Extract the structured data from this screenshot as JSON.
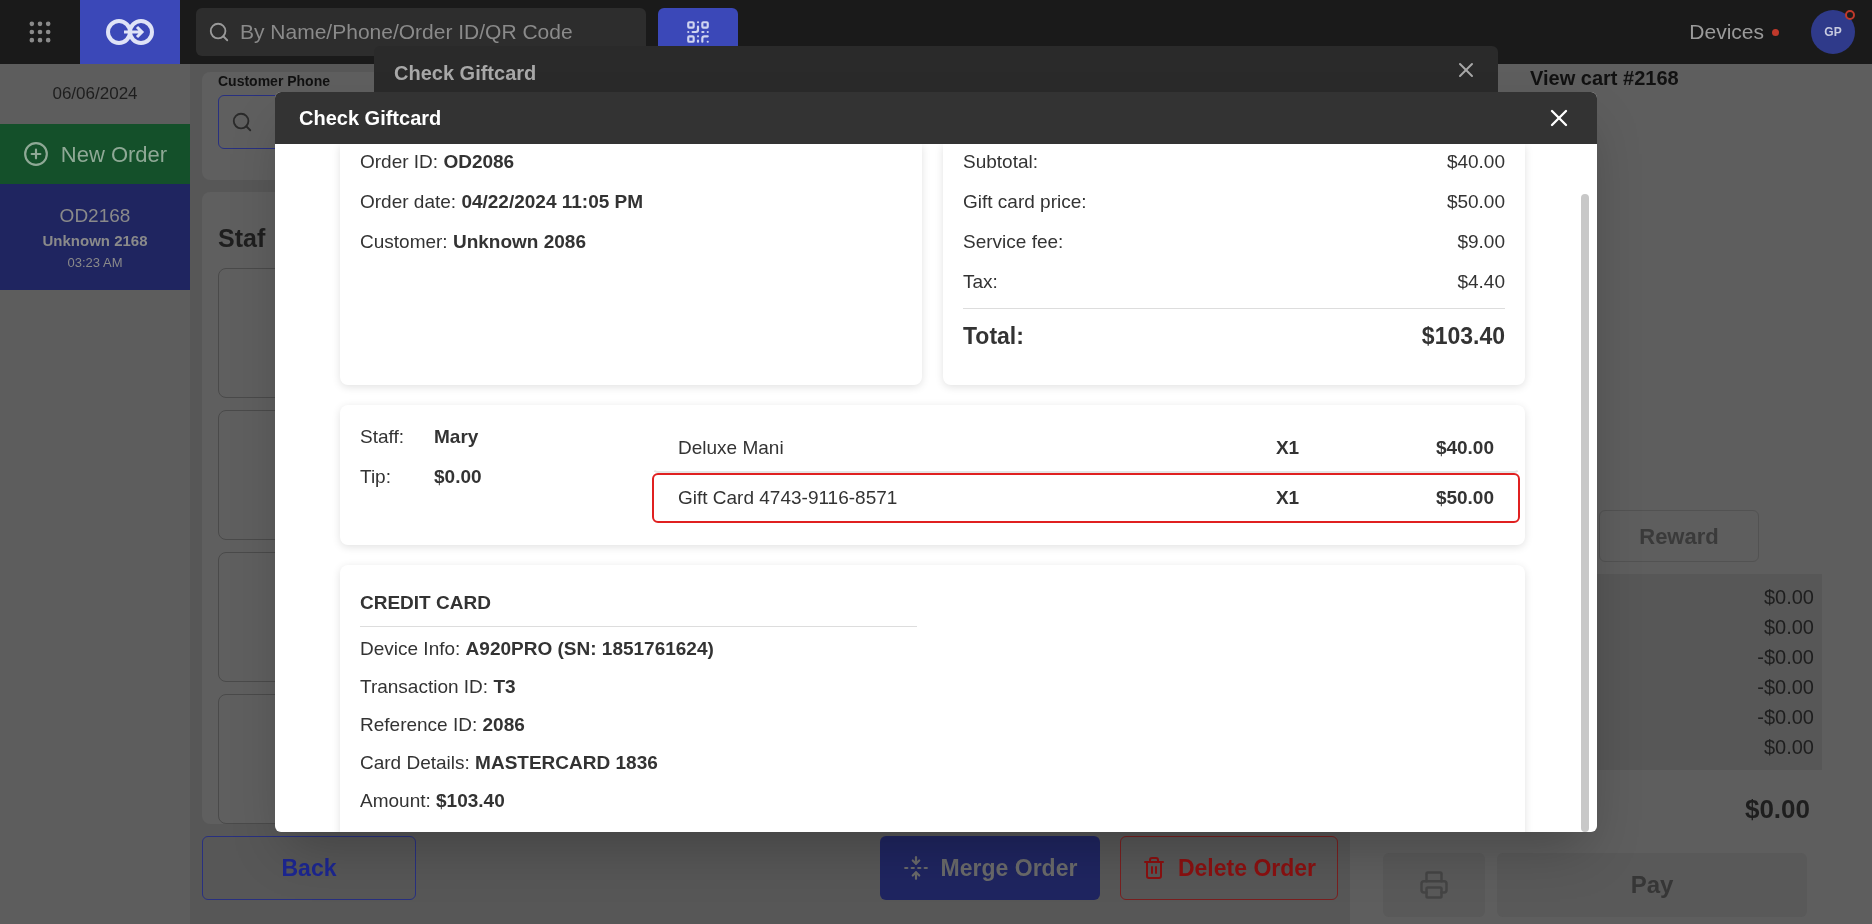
{
  "topbar": {
    "search_placeholder": "By Name/Phone/Order ID/QR Code",
    "devices_label": "Devices",
    "avatar": "GP"
  },
  "sidebar": {
    "date": "06/06/2024",
    "new_order": "New Order",
    "orders": [
      {
        "id": "OD2168",
        "customer": "Unknown 2168",
        "time": "03:23 AM",
        "selected": true
      }
    ]
  },
  "customer_panel": {
    "label": "Customer Phone"
  },
  "staff_panel": {
    "title": "Staf"
  },
  "footer_buttons": [
    {
      "label": "Back",
      "kind": "outline"
    },
    {
      "label": "Merge Order",
      "kind": "merge"
    },
    {
      "label": "Delete Order",
      "kind": "delete"
    }
  ],
  "cart": {
    "title": "View cart #2168",
    "reward": "Reward",
    "summary_values": [
      "$0.00",
      "$0.00",
      "-$0.00",
      "-$0.00",
      "-$0.00",
      "$0.00"
    ],
    "total": "$0.00",
    "pay": "Pay"
  },
  "back_dialog": {
    "title": "Check Giftcard"
  },
  "dialog": {
    "title": "Check Giftcard",
    "order_info": [
      {
        "label": "Order ID:",
        "value": "OD2086"
      },
      {
        "label": "Order date:",
        "value": "04/22/2024 11:05 PM"
      },
      {
        "label": "Customer:",
        "value": "Unknown 2086"
      }
    ],
    "totals": [
      {
        "label": "Subtotal:",
        "value": "$40.00"
      },
      {
        "label": "Gift card price:",
        "value": "$50.00"
      },
      {
        "label": "Service fee:",
        "value": "$9.00"
      },
      {
        "label": "Tax:",
        "value": "$4.40"
      }
    ],
    "total": {
      "label": "Total:",
      "value": "$103.40"
    },
    "staff": [
      {
        "label": "Staff:",
        "value": "Mary"
      },
      {
        "label": "Tip:",
        "value": "$0.00"
      }
    ],
    "items": [
      {
        "name": "Deluxe Mani",
        "qty": "X1",
        "price": "$40.00",
        "selected": false
      },
      {
        "name": "Gift Card 4743-9116-8571",
        "qty": "X1",
        "price": "$50.00",
        "selected": true
      }
    ],
    "payment": {
      "title": "CREDIT CARD",
      "details": [
        {
          "label": "Device Info:",
          "value": "A920PRO (SN: 1851761624)"
        },
        {
          "label": "Transaction ID:",
          "value": "T3"
        },
        {
          "label": "Reference ID:",
          "value": "2086"
        },
        {
          "label": "Card Details:",
          "value": "MASTERCARD 1836"
        },
        {
          "label": "Amount:",
          "value": "$103.40"
        }
      ]
    }
  }
}
